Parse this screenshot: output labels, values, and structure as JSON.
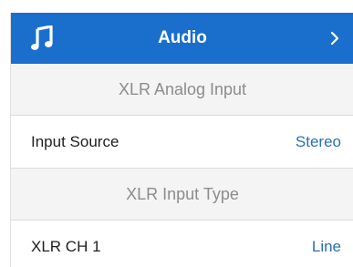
{
  "header": {
    "title": "Audio",
    "icon": "music-note-icon",
    "chevron_icon": "chevron-right-icon",
    "accent_color": "#1a6fcd"
  },
  "sections": [
    {
      "title": "XLR Analog Input",
      "rows": [
        {
          "label": "Input Source",
          "value": "Stereo"
        }
      ]
    },
    {
      "title": "XLR Input Type",
      "rows": [
        {
          "label": "XLR CH 1",
          "value": "Line"
        }
      ]
    }
  ]
}
